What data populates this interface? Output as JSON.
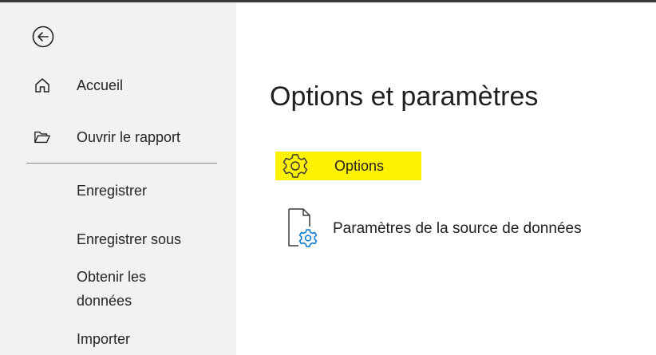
{
  "sidebar": {
    "back_label": "Back",
    "items": [
      {
        "label": "Accueil",
        "icon": "home-icon"
      },
      {
        "label": "Ouvrir le rapport",
        "icon": "folder-open-icon"
      },
      {
        "label": "Enregistrer"
      },
      {
        "label": "Enregistrer sous"
      },
      {
        "label": "Obtenir les données"
      },
      {
        "label": "Importer"
      }
    ]
  },
  "main": {
    "title": "Options et paramètres",
    "actions": [
      {
        "label": "Options",
        "icon": "gear-icon",
        "highlighted": true,
        "highlight_color": "#fff200"
      },
      {
        "label": "Paramètres de la source de données",
        "icon": "document-settings-icon"
      }
    ]
  },
  "colors": {
    "sidebar_bg": "#f3f2f1",
    "highlight": "#fff200",
    "accent": "#0078d4",
    "text": "#252423"
  }
}
